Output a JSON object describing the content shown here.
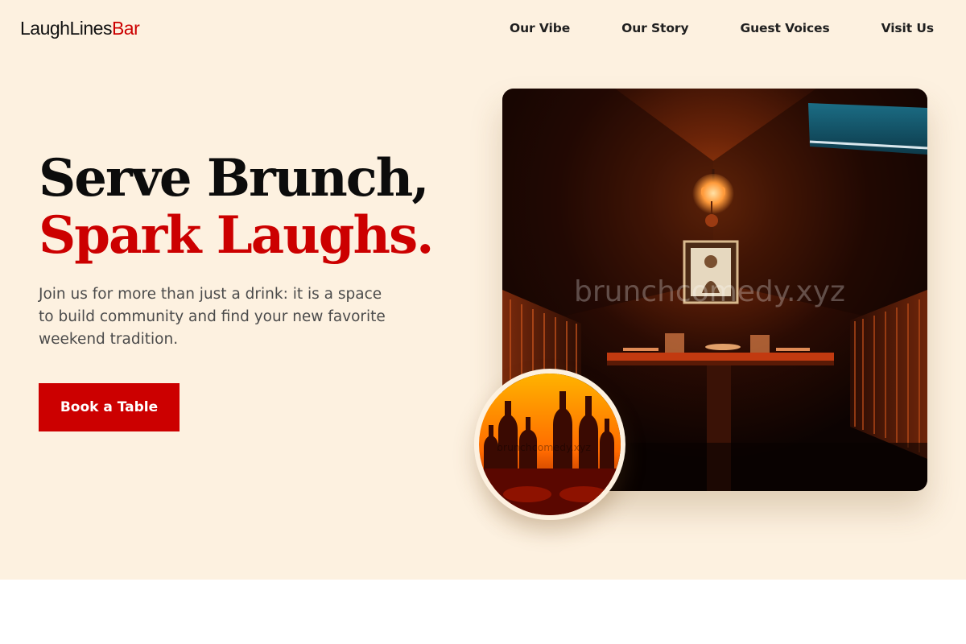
{
  "brand": {
    "name": "LaughLines",
    "accent": "Bar"
  },
  "nav": {
    "items": [
      {
        "label": "Our Vibe"
      },
      {
        "label": "Our Story"
      },
      {
        "label": "Guest Voices"
      },
      {
        "label": "Visit Us"
      }
    ]
  },
  "hero": {
    "headline_line1": "Serve Brunch,",
    "headline_line2": "Spark Laughs.",
    "lede": "Join us for more than just a drink: it is a space to build community and find your new favorite weekend tradition.",
    "cta_label": "Book a Table"
  },
  "images": {
    "main_watermark": "brunchcomedy.xyz",
    "circle_watermark": "brunchcomedy.xyz"
  },
  "colors": {
    "accent": "#cc0000",
    "hero_background": "#fdf1e0",
    "text_dark": "#0c0c0c",
    "text_muted": "#4b4b4b"
  }
}
